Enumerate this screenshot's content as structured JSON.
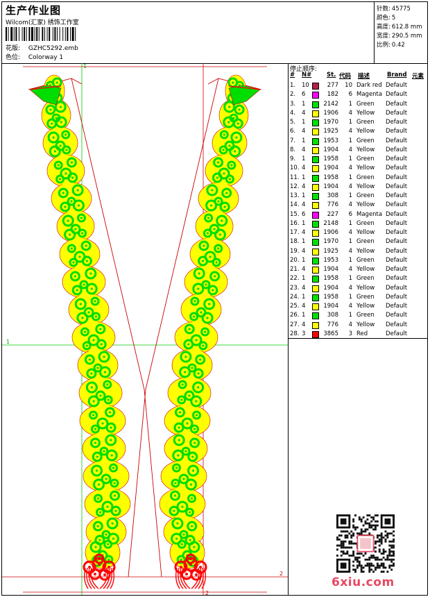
{
  "header": {
    "title": "生产作业图",
    "subtitle": "Wilcom(汇家) 绣饰工作室",
    "file_label": "花版:",
    "file_value": "GZHC5292.emb",
    "colorway_label": "色位:",
    "colorway_value": "Colorway 1"
  },
  "stats": [
    {
      "label": "针数:",
      "value": "45775"
    },
    {
      "label": "颜色:",
      "value": "5"
    },
    {
      "label": "高度:",
      "value": "612.8 mm"
    },
    {
      "label": "宽度:",
      "value": "290.5 mm"
    },
    {
      "label": "比例:",
      "value": "0.42"
    }
  ],
  "design": {
    "markers": {
      "left_h": "1",
      "top_v": "1",
      "right_h": "2",
      "bottom_v": "2"
    },
    "colors": {
      "green": "#00dd00",
      "yellow": "#ffff00",
      "red": "#ff0000",
      "outline": "#cc0000",
      "guide": "#00cc00"
    }
  },
  "stop_sequence": {
    "title": "停止顺序:",
    "columns": [
      "#",
      "N#",
      "St.",
      "代码",
      "描述",
      "Brand",
      "元素"
    ],
    "rows": [
      {
        "idx": "1.",
        "nd": "10",
        "st": "277",
        "code": "10",
        "desc": "Dark red",
        "brand": "Default",
        "color": "#b22244"
      },
      {
        "idx": "2.",
        "nd": "6",
        "st": "182",
        "code": "6",
        "desc": "Magenta",
        "brand": "Default",
        "color": "#ff00ff"
      },
      {
        "idx": "3.",
        "nd": "1",
        "st": "2142",
        "code": "1",
        "desc": "Green",
        "brand": "Default",
        "color": "#00e000"
      },
      {
        "idx": "4.",
        "nd": "4",
        "st": "1906",
        "code": "4",
        "desc": "Yellow",
        "brand": "Default",
        "color": "#ffff00"
      },
      {
        "idx": "5.",
        "nd": "1",
        "st": "1970",
        "code": "1",
        "desc": "Green",
        "brand": "Default",
        "color": "#00e000"
      },
      {
        "idx": "6.",
        "nd": "4",
        "st": "1925",
        "code": "4",
        "desc": "Yellow",
        "brand": "Default",
        "color": "#ffff00"
      },
      {
        "idx": "7.",
        "nd": "1",
        "st": "1953",
        "code": "1",
        "desc": "Green",
        "brand": "Default",
        "color": "#00e000"
      },
      {
        "idx": "8.",
        "nd": "4",
        "st": "1904",
        "code": "4",
        "desc": "Yellow",
        "brand": "Default",
        "color": "#ffff00"
      },
      {
        "idx": "9.",
        "nd": "1",
        "st": "1958",
        "code": "1",
        "desc": "Green",
        "brand": "Default",
        "color": "#00e000"
      },
      {
        "idx": "10.",
        "nd": "4",
        "st": "1904",
        "code": "4",
        "desc": "Yellow",
        "brand": "Default",
        "color": "#ffff00"
      },
      {
        "idx": "11.",
        "nd": "1",
        "st": "1958",
        "code": "1",
        "desc": "Green",
        "brand": "Default",
        "color": "#00e000"
      },
      {
        "idx": "12.",
        "nd": "4",
        "st": "1904",
        "code": "4",
        "desc": "Yellow",
        "brand": "Default",
        "color": "#ffff00"
      },
      {
        "idx": "13.",
        "nd": "1",
        "st": "308",
        "code": "1",
        "desc": "Green",
        "brand": "Default",
        "color": "#00e000"
      },
      {
        "idx": "14.",
        "nd": "4",
        "st": "776",
        "code": "4",
        "desc": "Yellow",
        "brand": "Default",
        "color": "#ffff00"
      },
      {
        "idx": "15.",
        "nd": "6",
        "st": "227",
        "code": "6",
        "desc": "Magenta",
        "brand": "Default",
        "color": "#ff00ff"
      },
      {
        "idx": "16.",
        "nd": "1",
        "st": "2148",
        "code": "1",
        "desc": "Green",
        "brand": "Default",
        "color": "#00e000"
      },
      {
        "idx": "17.",
        "nd": "4",
        "st": "1906",
        "code": "4",
        "desc": "Yellow",
        "brand": "Default",
        "color": "#ffff00"
      },
      {
        "idx": "18.",
        "nd": "1",
        "st": "1970",
        "code": "1",
        "desc": "Green",
        "brand": "Default",
        "color": "#00e000"
      },
      {
        "idx": "19.",
        "nd": "4",
        "st": "1925",
        "code": "4",
        "desc": "Yellow",
        "brand": "Default",
        "color": "#ffff00"
      },
      {
        "idx": "20.",
        "nd": "1",
        "st": "1953",
        "code": "1",
        "desc": "Green",
        "brand": "Default",
        "color": "#00e000"
      },
      {
        "idx": "21.",
        "nd": "4",
        "st": "1904",
        "code": "4",
        "desc": "Yellow",
        "brand": "Default",
        "color": "#ffff00"
      },
      {
        "idx": "22.",
        "nd": "1",
        "st": "1958",
        "code": "1",
        "desc": "Green",
        "brand": "Default",
        "color": "#00e000"
      },
      {
        "idx": "23.",
        "nd": "4",
        "st": "1904",
        "code": "4",
        "desc": "Yellow",
        "brand": "Default",
        "color": "#ffff00"
      },
      {
        "idx": "24.",
        "nd": "1",
        "st": "1958",
        "code": "1",
        "desc": "Green",
        "brand": "Default",
        "color": "#00e000"
      },
      {
        "idx": "25.",
        "nd": "4",
        "st": "1904",
        "code": "4",
        "desc": "Yellow",
        "brand": "Default",
        "color": "#ffff00"
      },
      {
        "idx": "26.",
        "nd": "1",
        "st": "308",
        "code": "1",
        "desc": "Green",
        "brand": "Default",
        "color": "#00e000"
      },
      {
        "idx": "27.",
        "nd": "4",
        "st": "776",
        "code": "4",
        "desc": "Yellow",
        "brand": "Default",
        "color": "#ffff00"
      },
      {
        "idx": "28.",
        "nd": "3",
        "st": "3865",
        "code": "3",
        "desc": "Red",
        "brand": "Default",
        "color": "#ff0000"
      }
    ]
  },
  "watermark": "6xiu.com"
}
